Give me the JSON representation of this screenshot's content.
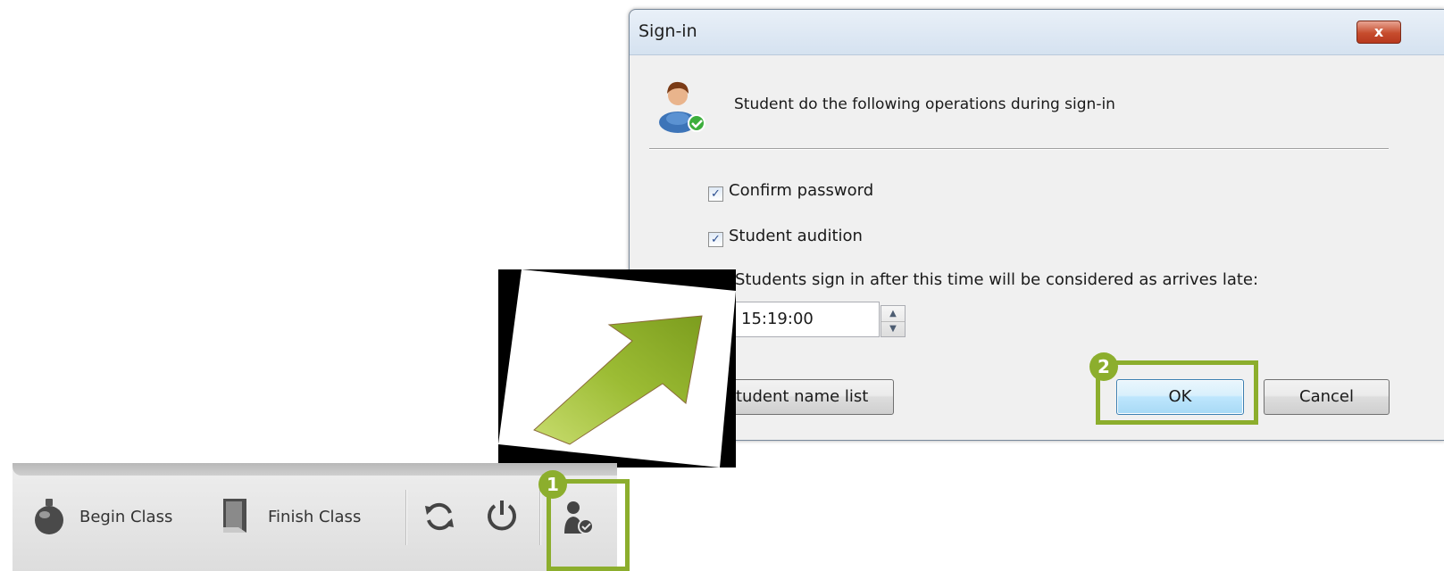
{
  "dialog": {
    "title": "Sign-in",
    "close_label": "x",
    "header_text": "Student do the following operations during sign-in",
    "options": [
      {
        "label": "Confirm password",
        "checked": true
      },
      {
        "label": "Student audition",
        "checked": true
      }
    ],
    "late_label": "Students sign in after this time will be considered as arrives late:",
    "late_time": "15:19:00",
    "namelist_button": "tudent name list",
    "ok_button": "OK",
    "cancel_button": "Cancel"
  },
  "toolbar": {
    "begin_class": "Begin Class",
    "finish_class": "Finish Class"
  },
  "badges": {
    "step1": "1",
    "step2": "2"
  },
  "colors": {
    "highlight": "#8cae2d",
    "arrow": "#9bbb2e"
  },
  "icons": [
    "user-check-icon",
    "bell-icon",
    "door-icon",
    "refresh-icon",
    "power-icon",
    "arrow-icon"
  ]
}
